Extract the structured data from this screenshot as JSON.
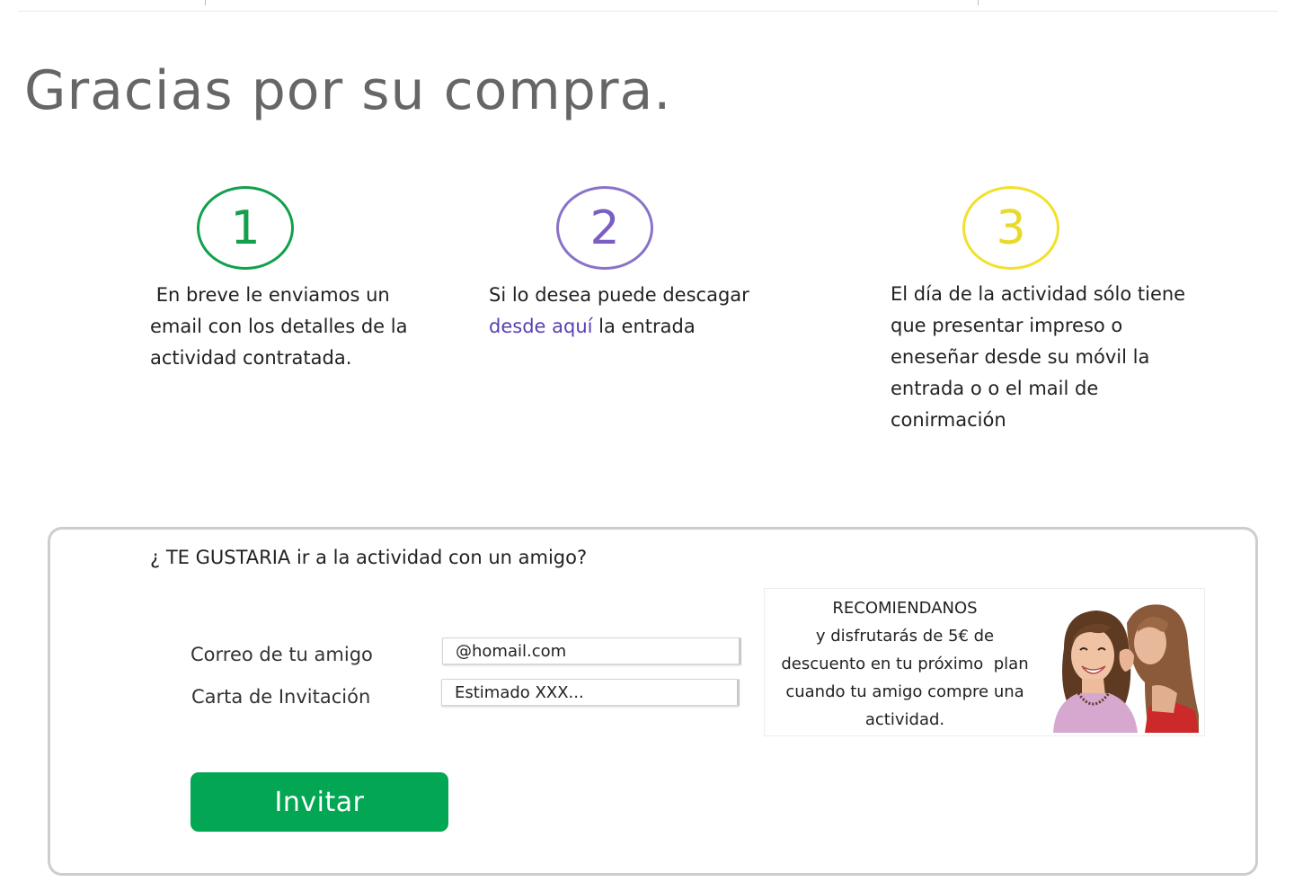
{
  "page": {
    "title": "Gracias por su compra."
  },
  "steps": [
    {
      "number": "1",
      "color": "#11a04c",
      "text": " En breve le enviamos un email con los detalles de la actividad contratada."
    },
    {
      "number": "2",
      "color": "#7a5fc0",
      "text_before": "Si lo desea puede descagar ",
      "link_label": "desde aquí",
      "text_after": " la entrada"
    },
    {
      "number": "3",
      "color": "#e9d92a",
      "text": "El día de la actividad sólo tiene que presentar impreso o eneseñar desde su móvil la entrada o o el mail de conirmación"
    }
  ],
  "invite": {
    "question": "¿ TE GUSTARIA ir a la actividad con un amigo?",
    "email_label": "Correo de tu amigo",
    "email_value": "@homail.com",
    "letter_label": "Carta de Invitación",
    "letter_value": "Estimado XXX...",
    "button_label": "Invitar",
    "button_color": "#02a653"
  },
  "promo": {
    "lines": [
      "RECOMIENDANOS",
      "y disfrutarás de 5€ de",
      "descuento en tu próximo  plan",
      "cuando tu amigo compre una",
      "actividad."
    ],
    "image_icon": "two-friends-whispering-photo"
  }
}
